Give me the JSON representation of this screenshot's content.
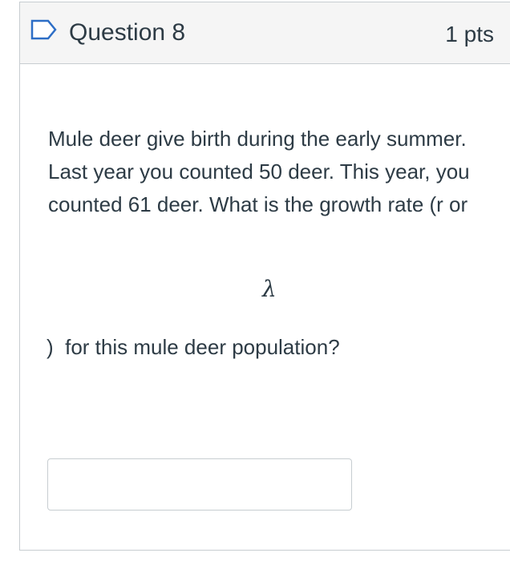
{
  "question": {
    "title": "Question 8",
    "points": "1 pts",
    "text": "Mule deer give birth during the early summer. Last year you counted 50 deer. This year, you counted 61 deer. What is the growth rate (r or",
    "symbol": "λ",
    "text_tail": ")  for this mule deer population?"
  },
  "answer": {
    "value": "",
    "placeholder": ""
  },
  "icons": {
    "flag": "flag-icon"
  },
  "colors": {
    "header_bg": "#f5f5f5",
    "border": "#c7cdd1",
    "text": "#2d3b45",
    "flag": "#2d6ec6"
  }
}
